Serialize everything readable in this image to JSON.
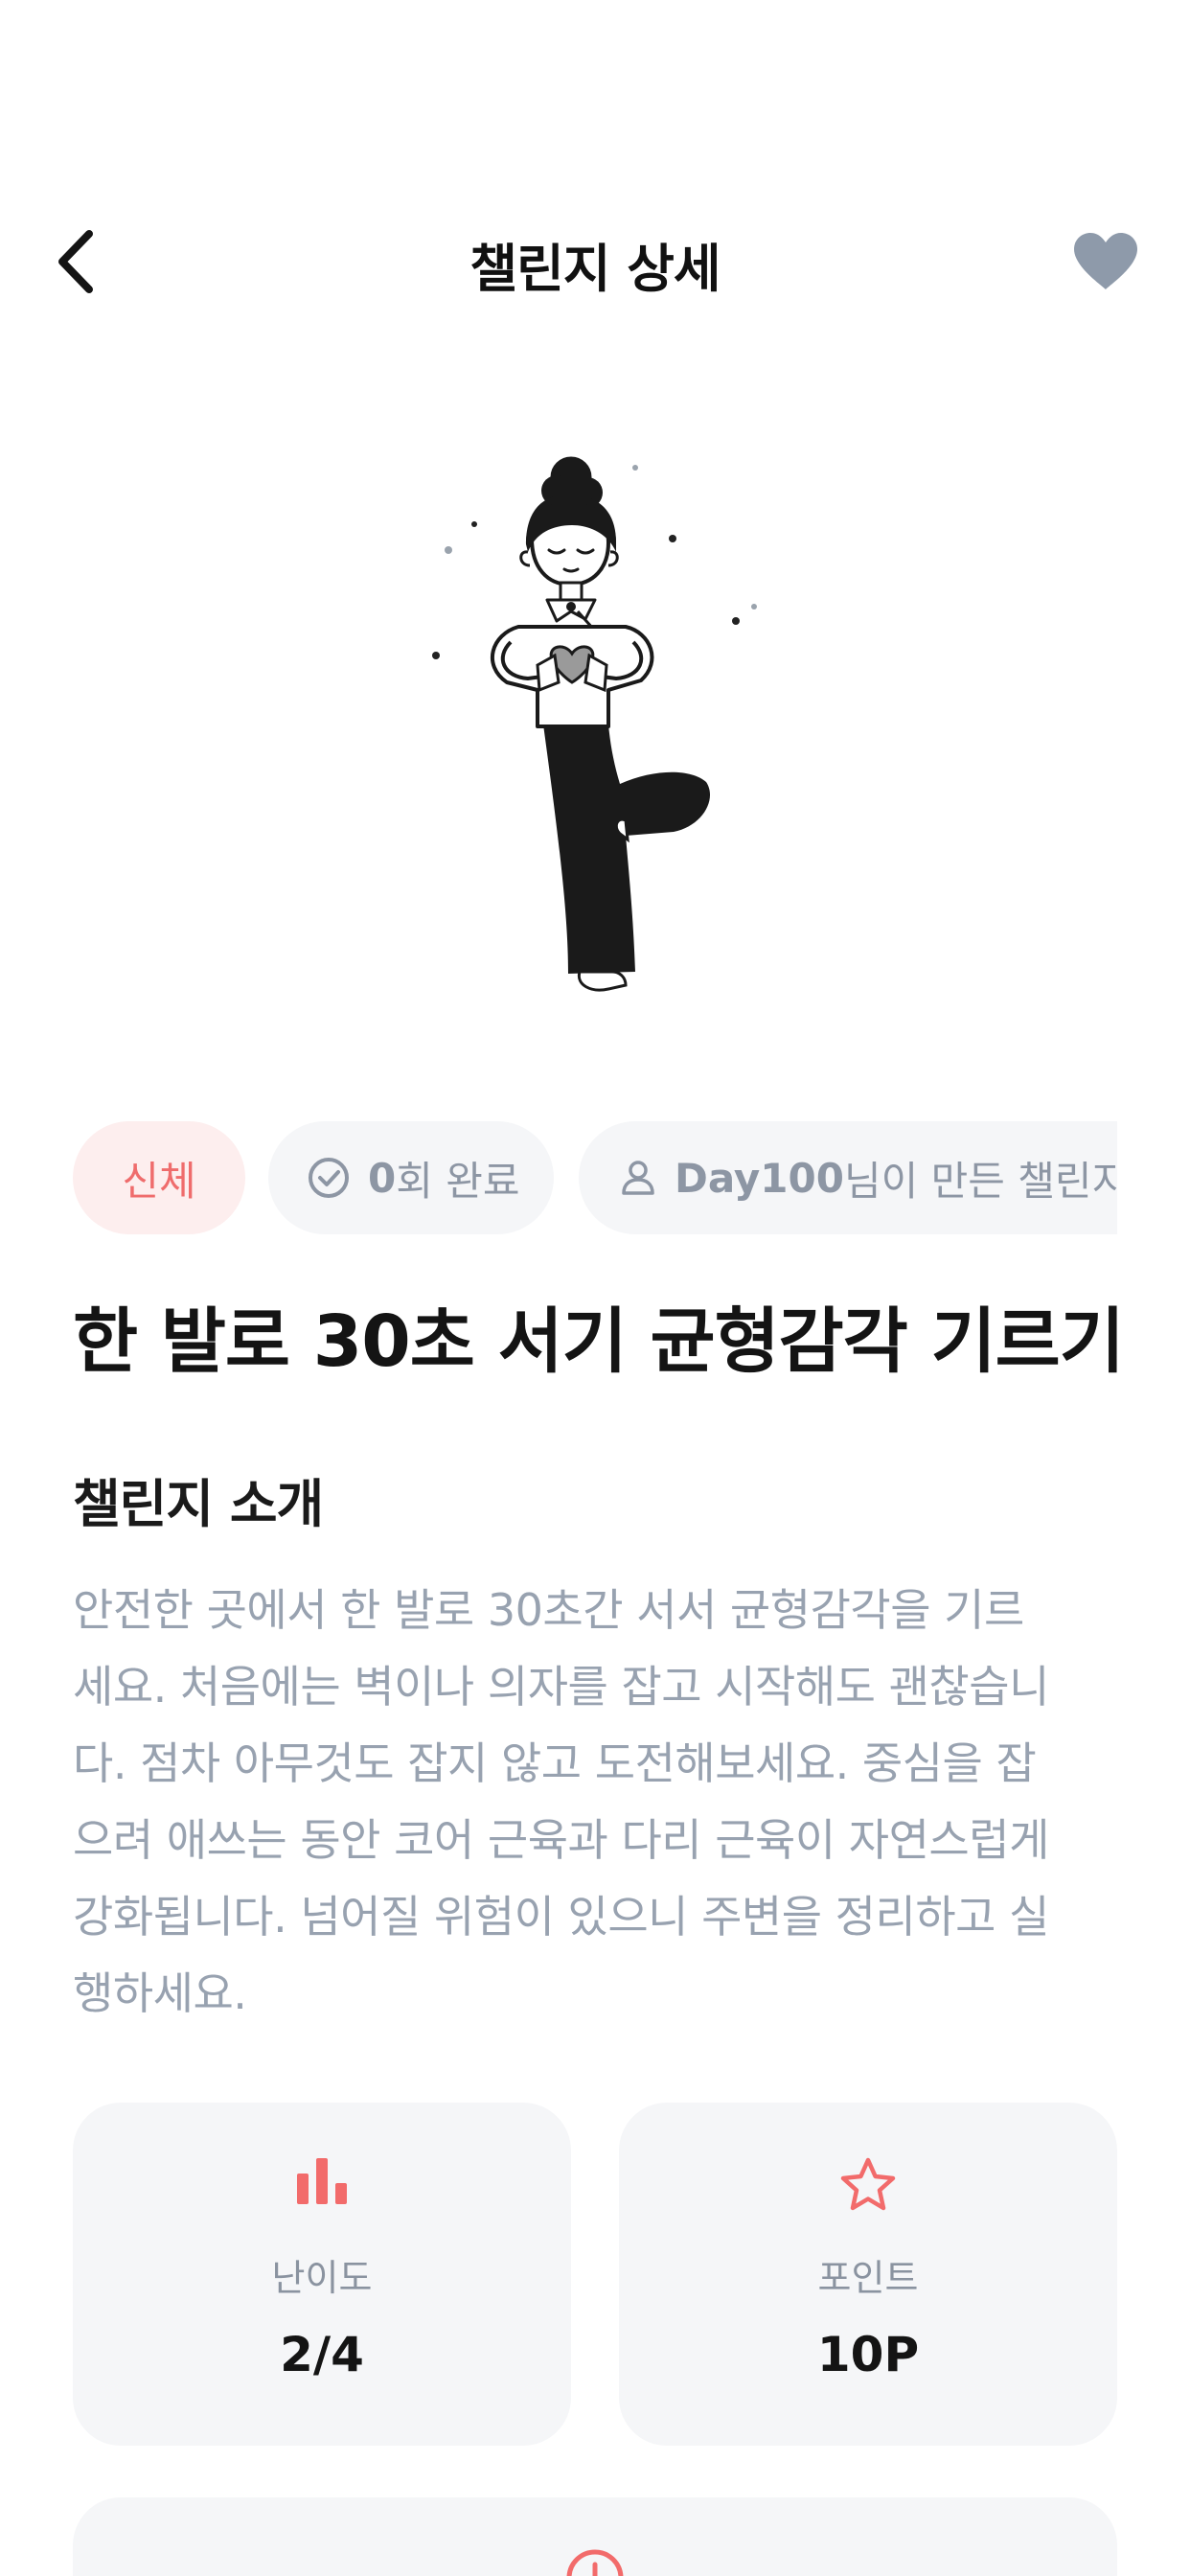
{
  "header": {
    "title": "챌린지 상세",
    "back_icon": "chevron-left-icon",
    "like_icon": "heart-icon",
    "like_color": "#8e9aaa"
  },
  "illustration": {
    "icon": "yoga-tree-pose-illustration"
  },
  "chips": {
    "category": "신체",
    "completed_count": "0",
    "completed_suffix": "회 완료",
    "creator_name": "Day100",
    "creator_suffix": "님이 만든 챌린지",
    "category_color": "#ef6c6c"
  },
  "challenge": {
    "title": "한 발로 30초 서기 균형감각 기르기",
    "section_heading": "챌린지 소개",
    "description_lines": [
      "안전한 곳에서 한 발로 30초간 서서 균형감각을 기르",
      "세요. 처음에는 벽이나 의자를 잡고 시작해도 괜찮습니",
      "다. 점차 아무것도 잡지 않고 도전해보세요. 중심을 잡",
      "으려 애쓰는 동안 코어 근육과 다리 근육이 자연스럽게",
      "강화됩니다. 넘어질 위험이 있으니 주변을 정리하고 실",
      "행하세요."
    ]
  },
  "stats": {
    "difficulty_label": "난이도",
    "difficulty_value": "2/4",
    "difficulty_icon": "bar-chart-icon",
    "points_label": "포인트",
    "points_value": "10P",
    "points_icon": "star-icon",
    "bottom_icon": "clock-icon",
    "accent": "#f26b6b"
  }
}
